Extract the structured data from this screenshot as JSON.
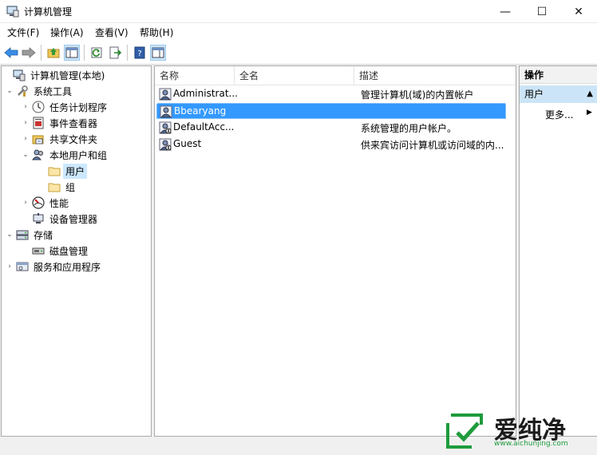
{
  "window": {
    "title": "计算机管理",
    "min_glyph": "—",
    "max_glyph": "☐",
    "close_glyph": "✕"
  },
  "menu": [
    "文件(F)",
    "操作(A)",
    "查看(V)",
    "帮助(H)"
  ],
  "toolbar": {
    "icons": [
      "back-icon",
      "forward-icon",
      "up-folder-icon",
      "show-hide-tree-icon",
      "refresh-icon",
      "export-list-icon",
      "help-icon",
      "show-hide-action-pane-icon"
    ]
  },
  "tree": {
    "items": [
      {
        "label": "计算机管理(本地)",
        "icon": "computer-management-icon",
        "chevron": "",
        "level": 0
      },
      {
        "label": "系统工具",
        "icon": "tools-icon",
        "chevron": "down",
        "level": 0
      },
      {
        "label": "任务计划程序",
        "icon": "clock-icon",
        "chevron": "right",
        "level": 1
      },
      {
        "label": "事件查看器",
        "icon": "event-viewer-icon",
        "chevron": "right",
        "level": 1
      },
      {
        "label": "共享文件夹",
        "icon": "shared-folder-icon",
        "chevron": "right",
        "level": 1
      },
      {
        "label": "本地用户和组",
        "icon": "users-groups-icon",
        "chevron": "down",
        "level": 1
      },
      {
        "label": "用户",
        "icon": "folder-icon",
        "chevron": "",
        "level": 2,
        "selected": true
      },
      {
        "label": "组",
        "icon": "folder-icon",
        "chevron": "",
        "level": 2
      },
      {
        "label": "性能",
        "icon": "performance-icon",
        "chevron": "right",
        "level": 1
      },
      {
        "label": "设备管理器",
        "icon": "device-manager-icon",
        "chevron": "",
        "level": 1
      },
      {
        "label": "存储",
        "icon": "storage-icon",
        "chevron": "down",
        "level": 0
      },
      {
        "label": "磁盘管理",
        "icon": "disk-management-icon",
        "chevron": "",
        "level": 1
      },
      {
        "label": "服务和应用程序",
        "icon": "services-icon",
        "chevron": "right",
        "level": 0
      }
    ]
  },
  "list": {
    "columns": [
      "名称",
      "全名",
      "描述"
    ],
    "rows": [
      {
        "name": "Administrat...",
        "fullname": "",
        "desc": "管理计算机(域)的内置帐户"
      },
      {
        "name": "Bbearyang",
        "fullname": "",
        "desc": "",
        "selected": true
      },
      {
        "name": "DefaultAcc...",
        "fullname": "",
        "desc": "系统管理的用户帐户。"
      },
      {
        "name": "Guest",
        "fullname": "",
        "desc": "供来宾访问计算机或访问域的内..."
      }
    ]
  },
  "actions": {
    "title": "操作",
    "section": "用户",
    "more": "更多...",
    "section_glyph": "▲",
    "more_glyph": "▶"
  },
  "watermark": {
    "brand": "爱纯净",
    "url": "www.aichunjing.com"
  },
  "colors": {
    "selection": "#3399ff",
    "tree_selection": "#cce8ff",
    "action_section": "#cce4f7",
    "watermark_green": "#1e9b3c"
  }
}
